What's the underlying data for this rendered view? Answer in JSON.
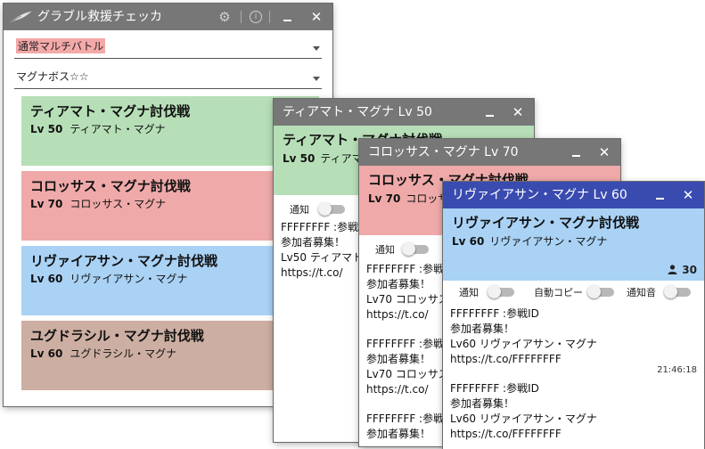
{
  "main": {
    "title": "グラブル救援チェッカ",
    "filter1": "通常マルチバトル",
    "filter2": "マグナボス☆☆",
    "raids": [
      {
        "title": "ティアマト・マグナ討伐戦",
        "level": "Lv 50",
        "name": "ティアマト・マグナ",
        "color": "#b7dfb7"
      },
      {
        "title": "コロッサス・マグナ討伐戦",
        "level": "Lv 70",
        "name": "コロッサス・マグナ",
        "color": "#efa9a9"
      },
      {
        "title": "リヴァイアサン・マグナ討伐戦",
        "level": "Lv 60",
        "name": "リヴァイアサン・マグナ",
        "color": "#a9d2f5"
      },
      {
        "title": "ユグドラシル・マグナ討伐戦",
        "level": "Lv 60",
        "name": "ユグドラシル・マグナ",
        "color": "#cdaea2"
      }
    ]
  },
  "win_tiamat": {
    "title": "ティアマト・マグナ Lv 50",
    "heading": "ティアマト・マグナ討伐戦",
    "level": "Lv 50",
    "name": "ティアマト・マグナ",
    "notify_label": "通知",
    "tweet": {
      "id": "FFFFFFFF :参戦ID",
      "line2": "参加者募集！",
      "line3": "Lv50 ティアマト・マグナ",
      "line4": "https://t.co/"
    }
  },
  "win_colossus": {
    "title": "コロッサス・マグナ Lv 70",
    "heading": "コロッサス・マグナ討伐戦",
    "level": "Lv 70",
    "name": "コロッサス・マグナ",
    "notify_label": "通知",
    "tweets": [
      {
        "id": "FFFFFFFF :参戦ID",
        "line2": "参加者募集！",
        "line3": "Lv70 コロッサス・マグナ",
        "line4": "https://t.co/"
      },
      {
        "id": "FFFFFFFF :参戦ID",
        "line2": "参加者募集！",
        "line3": "Lv70 コロッサス・マグナ",
        "line4": "https://t.co/"
      },
      {
        "id": "FFFFFFFF :参戦ID",
        "line2": "参加者募集！"
      }
    ]
  },
  "win_leviathan": {
    "title": "リヴァイアサン・マグナ Lv 60",
    "heading": "リヴァイアサン・マグナ討伐戦",
    "level": "Lv 60",
    "name": "リヴァイアサン・マグナ",
    "count": "30",
    "notify_label": "通知",
    "auto_copy_label": "自動コピー",
    "sound_label": "通知音",
    "tweets": [
      {
        "id": "FFFFFFFF :参戦ID",
        "line2": "参加者募集！",
        "line3": "Lv60 リヴァイアサン・マグナ",
        "line4": "https://t.co/FFFFFFFF",
        "time": "21:46:18"
      },
      {
        "id": "FFFFFFFF :参戦ID",
        "line2": "参加者募集！",
        "line3": "Lv60 リヴァイアサン・マグナ",
        "line4": "https://t.co/FFFFFFFF"
      }
    ]
  }
}
